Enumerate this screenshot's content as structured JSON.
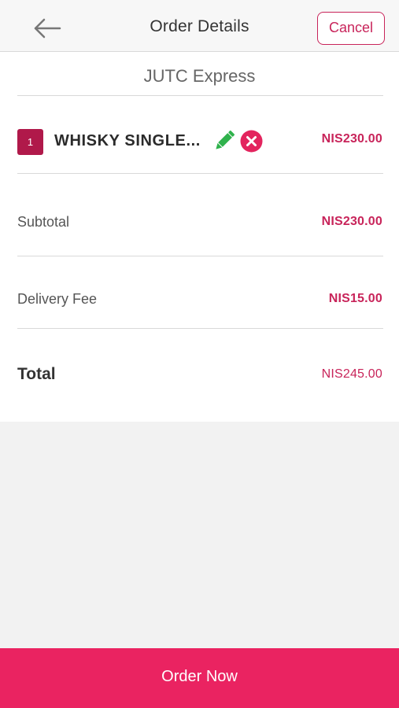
{
  "header": {
    "title": "Order Details",
    "back_icon": "arrow-left-icon",
    "cancel_label": "Cancel"
  },
  "store": {
    "name": "JUTC Express"
  },
  "items": [
    {
      "quantity": "1",
      "name": "WHISKY SINGLE...",
      "price": "NIS230.00",
      "edit_icon": "pencil-icon",
      "remove_icon": "close-circle-icon"
    }
  ],
  "summary": {
    "subtotal_label": "Subtotal",
    "subtotal_value": "NIS230.00",
    "delivery_label": "Delivery Fee",
    "delivery_value": "NIS15.00",
    "total_label": "Total",
    "total_value": "NIS245.00"
  },
  "footer": {
    "order_label": "Order Now"
  },
  "colors": {
    "accent": "#c8245a",
    "button": "#ea2361",
    "badge": "#b0194a",
    "edit_icon": "#2fb24c"
  }
}
